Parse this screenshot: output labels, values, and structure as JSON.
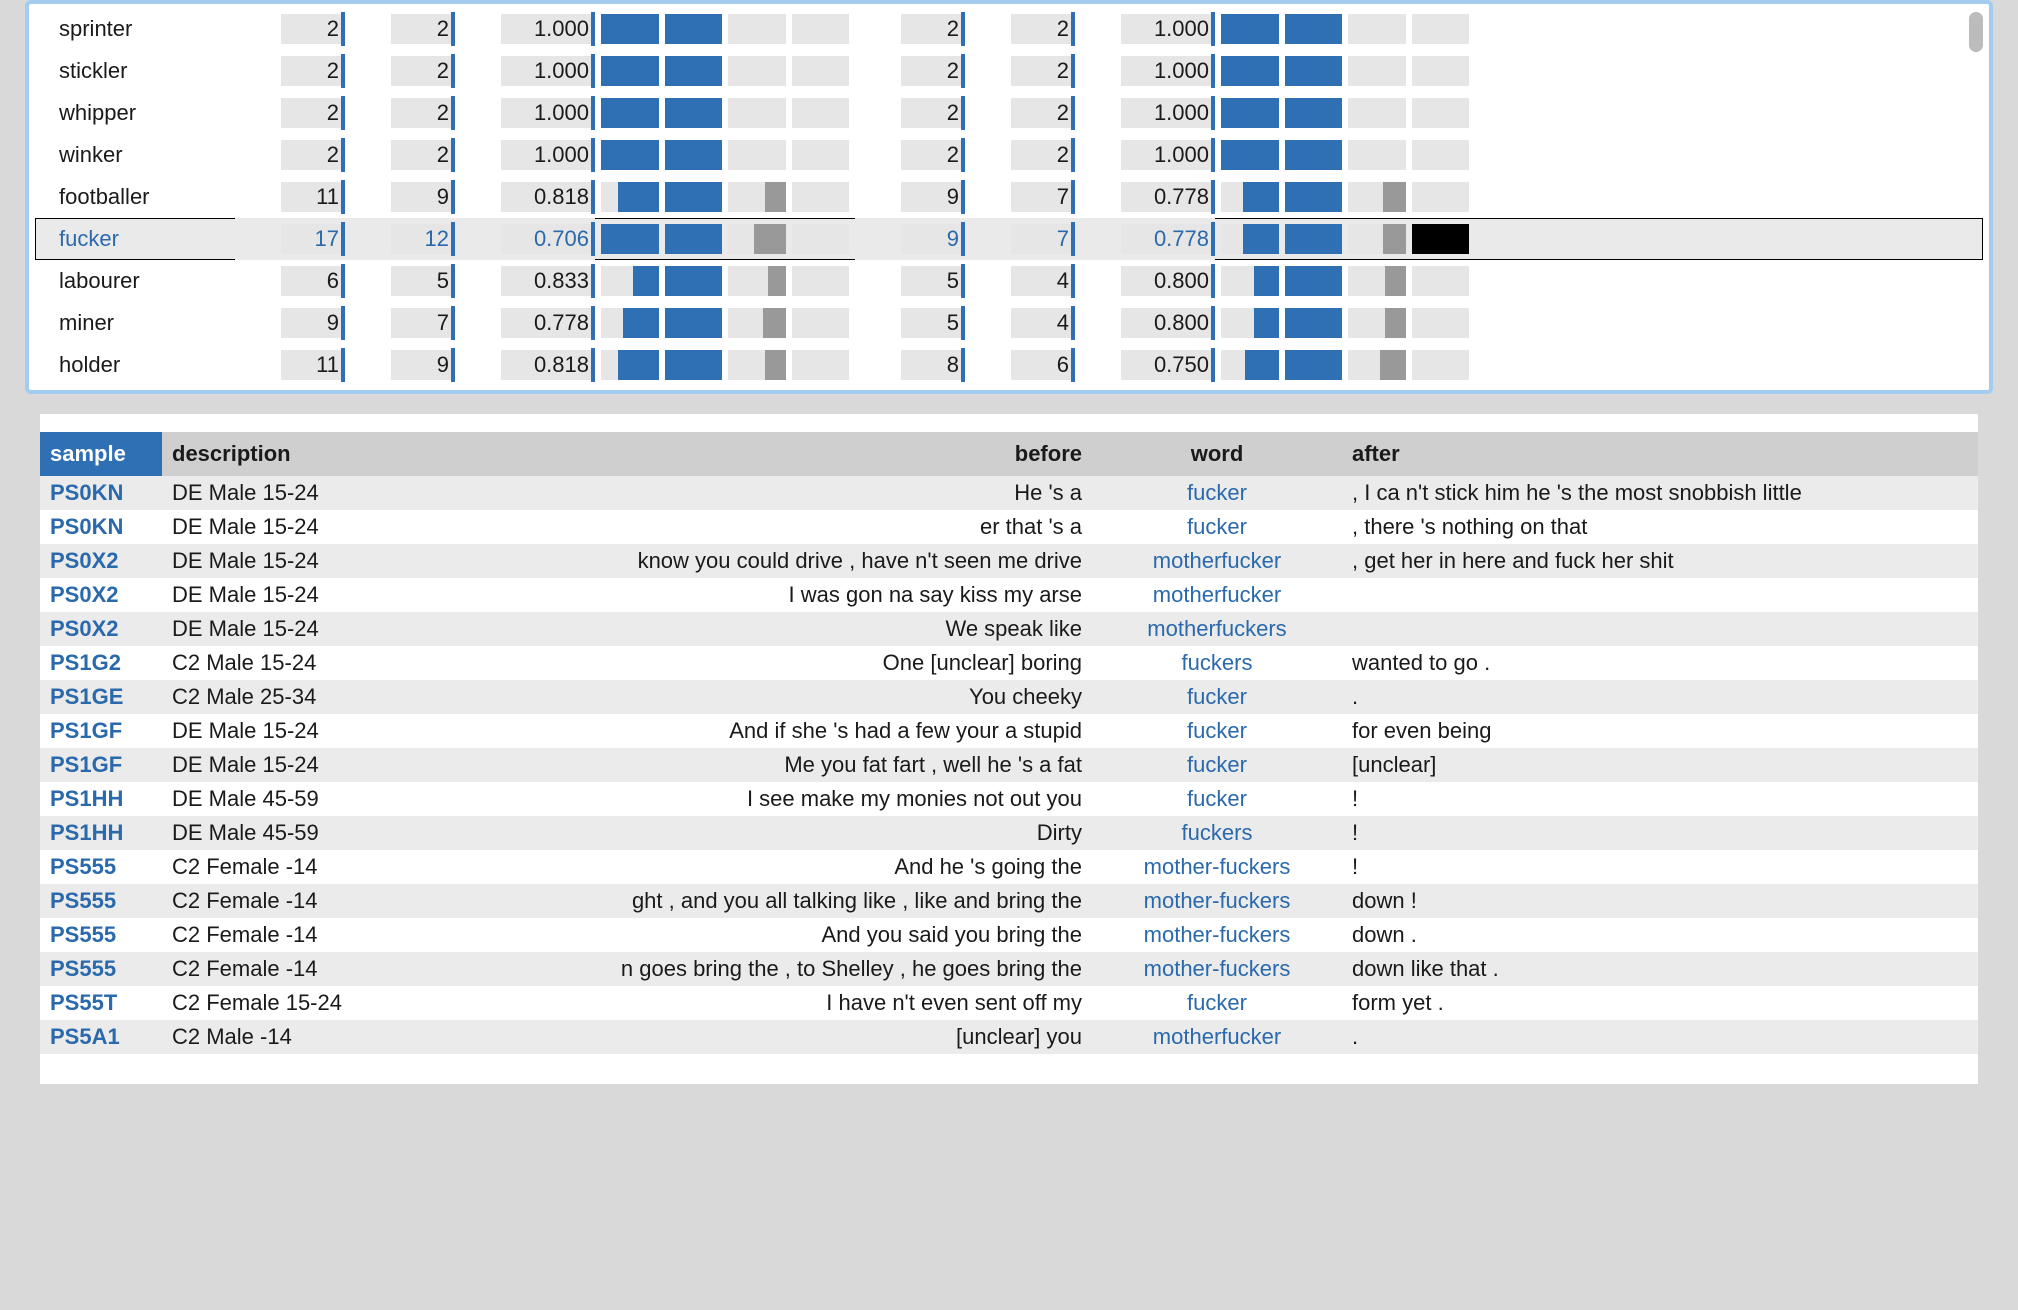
{
  "freq": {
    "rows": [
      {
        "name": "sprinter",
        "a1": 2,
        "a2": 2,
        "ar": "1.000",
        "bars_a": [
          100,
          100,
          0,
          0
        ],
        "b1": 2,
        "b2": 2,
        "br": "1.000",
        "bars_b": [
          100,
          100,
          0,
          0
        ],
        "selected": false
      },
      {
        "name": "stickler",
        "a1": 2,
        "a2": 2,
        "ar": "1.000",
        "bars_a": [
          100,
          100,
          0,
          0
        ],
        "b1": 2,
        "b2": 2,
        "br": "1.000",
        "bars_b": [
          100,
          100,
          0,
          0
        ],
        "selected": false
      },
      {
        "name": "whipper",
        "a1": 2,
        "a2": 2,
        "ar": "1.000",
        "bars_a": [
          100,
          100,
          0,
          0
        ],
        "b1": 2,
        "b2": 2,
        "br": "1.000",
        "bars_b": [
          100,
          100,
          0,
          0
        ],
        "selected": false
      },
      {
        "name": "winker",
        "a1": 2,
        "a2": 2,
        "ar": "1.000",
        "bars_a": [
          100,
          100,
          0,
          0
        ],
        "b1": 2,
        "b2": 2,
        "br": "1.000",
        "bars_b": [
          100,
          100,
          0,
          0
        ],
        "selected": false
      },
      {
        "name": "footballer",
        "a1": 11,
        "a2": 9,
        "ar": "0.818",
        "bars_a": [
          70,
          100,
          35,
          0
        ],
        "b1": 9,
        "b2": 7,
        "br": "0.778",
        "bars_b": [
          62,
          100,
          40,
          0
        ],
        "selected": false
      },
      {
        "name": "fucker",
        "a1": 17,
        "a2": 12,
        "ar": "0.706",
        "bars_a": [
          100,
          100,
          55,
          0
        ],
        "b1": 9,
        "b2": 7,
        "br": "0.778",
        "bars_b": [
          62,
          100,
          40,
          100
        ],
        "selected": true
      },
      {
        "name": "labourer",
        "a1": 6,
        "a2": 5,
        "ar": "0.833",
        "bars_a": [
          45,
          100,
          30,
          0
        ],
        "b1": 5,
        "b2": 4,
        "br": "0.800",
        "bars_b": [
          42,
          100,
          35,
          0
        ],
        "selected": false
      },
      {
        "name": "miner",
        "a1": 9,
        "a2": 7,
        "ar": "0.778",
        "bars_a": [
          62,
          100,
          40,
          0
        ],
        "b1": 5,
        "b2": 4,
        "br": "0.800",
        "bars_b": [
          42,
          100,
          35,
          0
        ],
        "selected": false
      },
      {
        "name": "holder",
        "a1": 11,
        "a2": 9,
        "ar": "0.818",
        "bars_a": [
          70,
          100,
          35,
          0
        ],
        "b1": 8,
        "b2": 6,
        "br": "0.750",
        "bars_b": [
          58,
          100,
          45,
          0
        ],
        "selected": false
      }
    ]
  },
  "conc": {
    "headers": {
      "sample": "sample",
      "description": "description",
      "before": "before",
      "word": "word",
      "after": "after"
    },
    "rows": [
      {
        "sample": "PS0KN",
        "desc": "DE Male 15-24",
        "before": "He 's a",
        "word": "fucker",
        "after": ", I ca n't stick him he 's the most snobbish little"
      },
      {
        "sample": "PS0KN",
        "desc": "DE Male 15-24",
        "before": "er that 's a",
        "word": "fucker",
        "after": ", there 's nothing on that"
      },
      {
        "sample": "PS0X2",
        "desc": "DE Male 15-24",
        "before": "know you could drive , have n't seen me drive",
        "word": "motherfucker",
        "after": ", get her in here and fuck her shit"
      },
      {
        "sample": "PS0X2",
        "desc": "DE Male 15-24",
        "before": "I was gon na say kiss my arse",
        "word": "motherfucker",
        "after": ""
      },
      {
        "sample": "PS0X2",
        "desc": "DE Male 15-24",
        "before": "We speak like",
        "word": "motherfuckers",
        "after": ""
      },
      {
        "sample": "PS1G2",
        "desc": "C2 Male 15-24",
        "before": "One [unclear] boring",
        "word": "fuckers",
        "after": "wanted to go ."
      },
      {
        "sample": "PS1GE",
        "desc": "C2 Male 25-34",
        "before": "You cheeky",
        "word": "fucker",
        "after": "."
      },
      {
        "sample": "PS1GF",
        "desc": "DE Male 15-24",
        "before": "And if she 's had a few your a stupid",
        "word": "fucker",
        "after": "for even being"
      },
      {
        "sample": "PS1GF",
        "desc": "DE Male 15-24",
        "before": "Me you fat fart , well he 's a fat",
        "word": "fucker",
        "after": "[unclear]"
      },
      {
        "sample": "PS1HH",
        "desc": "DE Male 45-59",
        "before": "I see make my monies not out you",
        "word": "fucker",
        "after": "!"
      },
      {
        "sample": "PS1HH",
        "desc": "DE Male 45-59",
        "before": "Dirty",
        "word": "fuckers",
        "after": "!"
      },
      {
        "sample": "PS555",
        "desc": "C2 Female -14",
        "before": "And he 's going the",
        "word": "mother-fuckers",
        "after": "!"
      },
      {
        "sample": "PS555",
        "desc": "C2 Female -14",
        "before": "ght , and you all talking like , like and bring the",
        "word": "mother-fuckers",
        "after": "down !"
      },
      {
        "sample": "PS555",
        "desc": "C2 Female -14",
        "before": "And you said you bring the",
        "word": "mother-fuckers",
        "after": "down ."
      },
      {
        "sample": "PS555",
        "desc": "C2 Female -14",
        "before": "n goes bring the , to Shelley , he goes bring the",
        "word": "mother-fuckers",
        "after": "down like that ."
      },
      {
        "sample": "PS55T",
        "desc": "C2 Female 15-24",
        "before": "I have n't even sent off my",
        "word": "fucker",
        "after": "form yet ."
      },
      {
        "sample": "PS5A1",
        "desc": "C2 Male -14",
        "before": "[unclear] you",
        "word": "motherfucker",
        "after": "."
      }
    ]
  }
}
